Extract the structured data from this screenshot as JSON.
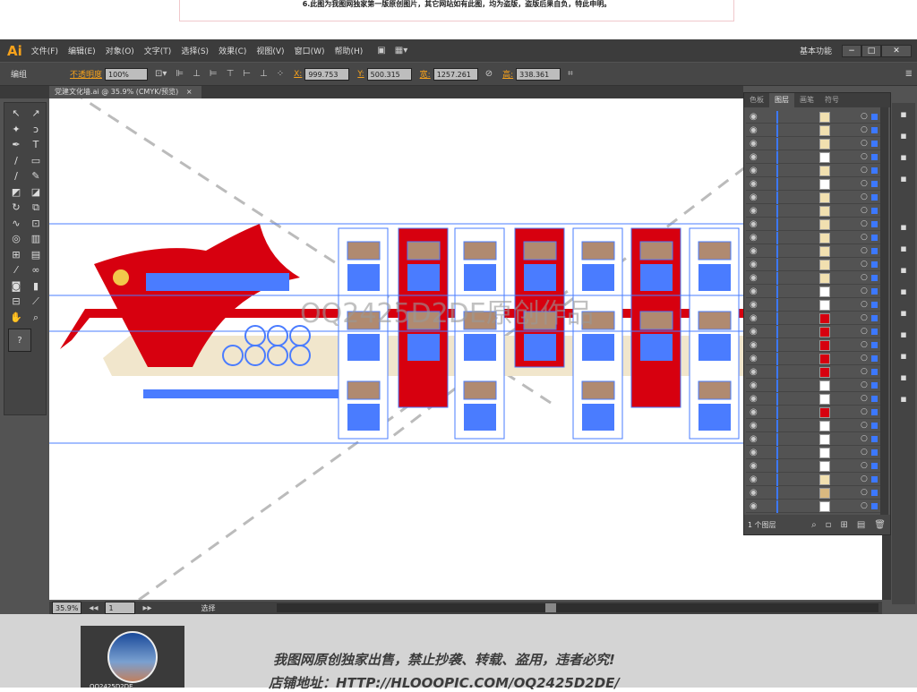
{
  "notice": "6.此图为我图网独家第一版原创图片，其它网站如有此图，均为盗版，盗版后果自负，特此申明。",
  "app": {
    "logo": "Ai",
    "menus": [
      "文件(F)",
      "编辑(E)",
      "对象(O)",
      "文字(T)",
      "选择(S)",
      "效果(C)",
      "视图(V)",
      "窗口(W)",
      "帮助(H)"
    ],
    "workspace": "基本功能",
    "min": "−",
    "max": "□",
    "close": "✕"
  },
  "control": {
    "selection": "编组",
    "opacity_label": "不透明度",
    "opacity": "100%",
    "x_label": "X:",
    "x": "999.753",
    "y_label": "Y:",
    "y": "500.315",
    "w_label": "宽:",
    "w": "1257.261",
    "h_label": "高:",
    "h": "338.361"
  },
  "document": {
    "tab": "党建文化墙.ai @ 35.9% (CMYK/预览)",
    "tab_close": "×"
  },
  "layers_panel": {
    "tabs": [
      "色板",
      "图层",
      "画笔",
      "符号"
    ],
    "active_tab": "图层",
    "count": "1 个图层"
  },
  "status": {
    "zoom": "35.9%",
    "page": "1",
    "tool": "选择"
  },
  "artwork": {
    "watermark": "OQ2425D2DE原创作品",
    "slogan_color": "#d7000f",
    "selection_color": "#4a7cff"
  },
  "footer": {
    "line1": "我图网原创独家出售，禁止抄袭、转载、盗用，违者必究!",
    "line2": "店铺地址：HTTP://HLOOOPIC.COM/OQ2425D2DE/",
    "avatar_label": "OQ2425D2DE"
  }
}
